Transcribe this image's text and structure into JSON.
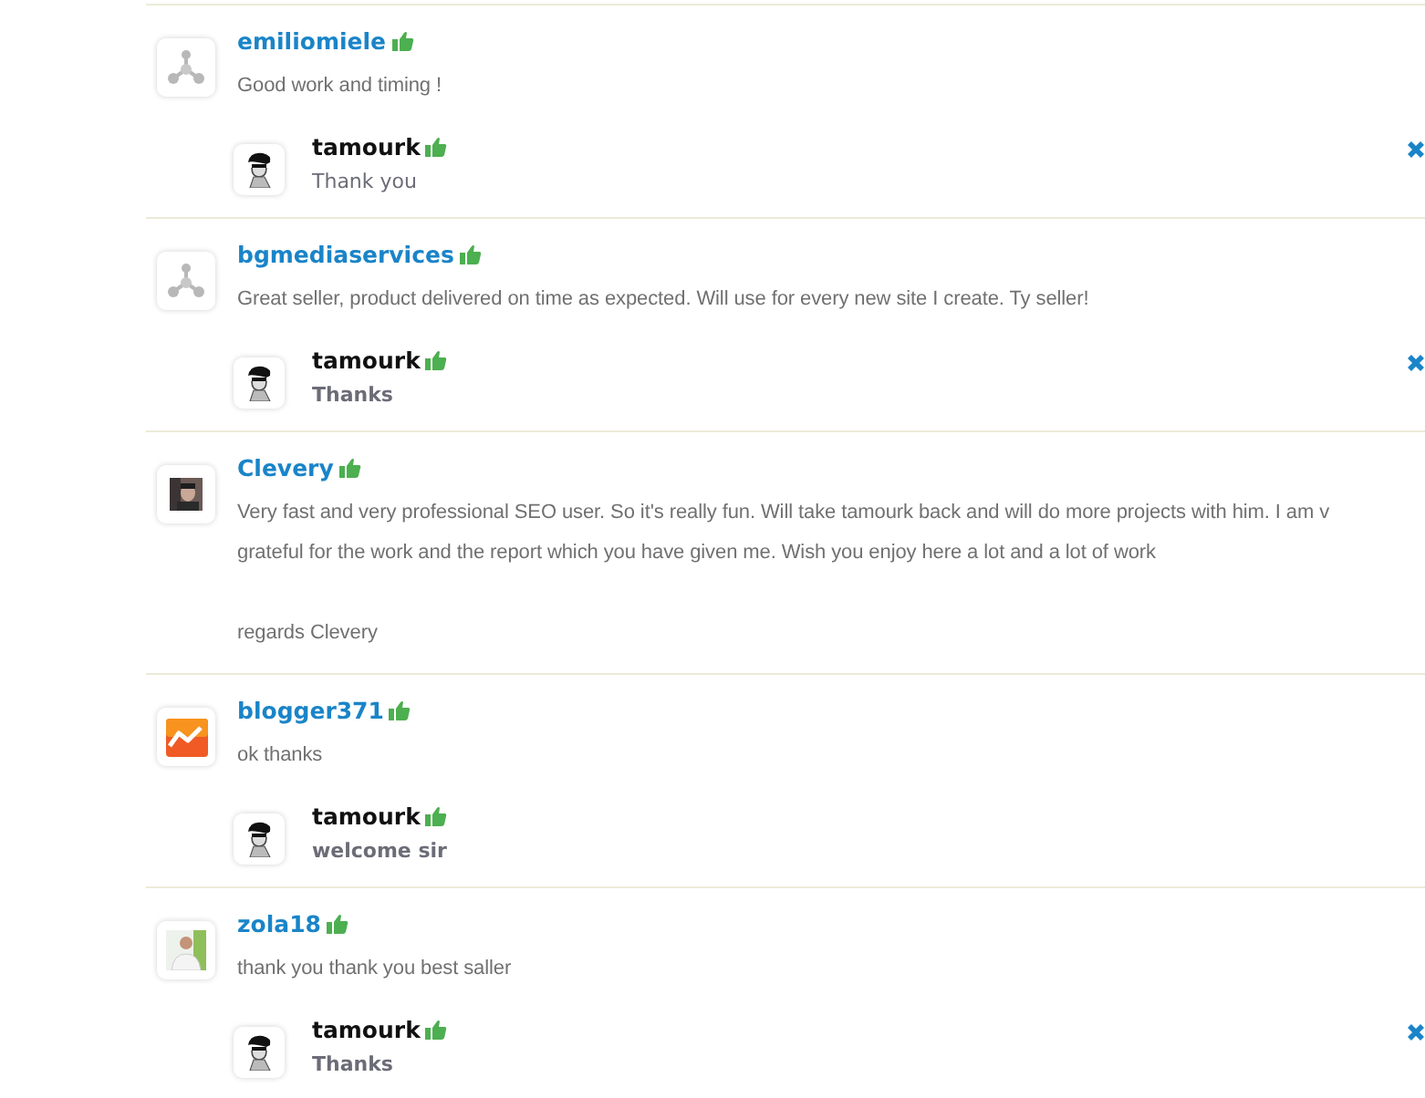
{
  "reviews": [
    {
      "author": "emiliomiele",
      "avatar": {
        "kind": "network"
      },
      "lines": [
        "Good work and timing !"
      ],
      "reply": {
        "author": "tamourk",
        "text": "Thank you",
        "bold": false,
        "deletable": true
      }
    },
    {
      "author": "bgmediaservices",
      "avatar": {
        "kind": "network"
      },
      "lines": [
        "Great seller, product delivered on time as expected. Will use for every new site I create. Ty seller!"
      ],
      "reply": {
        "author": "tamourk",
        "text": "Thanks",
        "bold": true,
        "deletable": true
      }
    },
    {
      "author": "Clevery",
      "avatar": {
        "kind": "portrait"
      },
      "lines": [
        "Very fast and very professional SEO user. So it's really fun. Will take tamourk back and will do more projects with him. I am v",
        "grateful for the work and the report which you have given me. Wish you enjoy here a lot and a lot of work"
      ],
      "signoff": "regards Clevery"
    },
    {
      "author": "blogger371",
      "avatar": {
        "kind": "chart"
      },
      "lines": [
        "ok thanks"
      ],
      "reply": {
        "author": "tamourk",
        "text": "welcome sir",
        "bold": true,
        "deletable": false
      }
    },
    {
      "author": "zola18",
      "avatar": {
        "kind": "person"
      },
      "lines": [
        "thank you thank you best saller"
      ],
      "reply": {
        "author": "tamourk",
        "text": "Thanks",
        "bold": true,
        "deletable": true
      }
    }
  ]
}
